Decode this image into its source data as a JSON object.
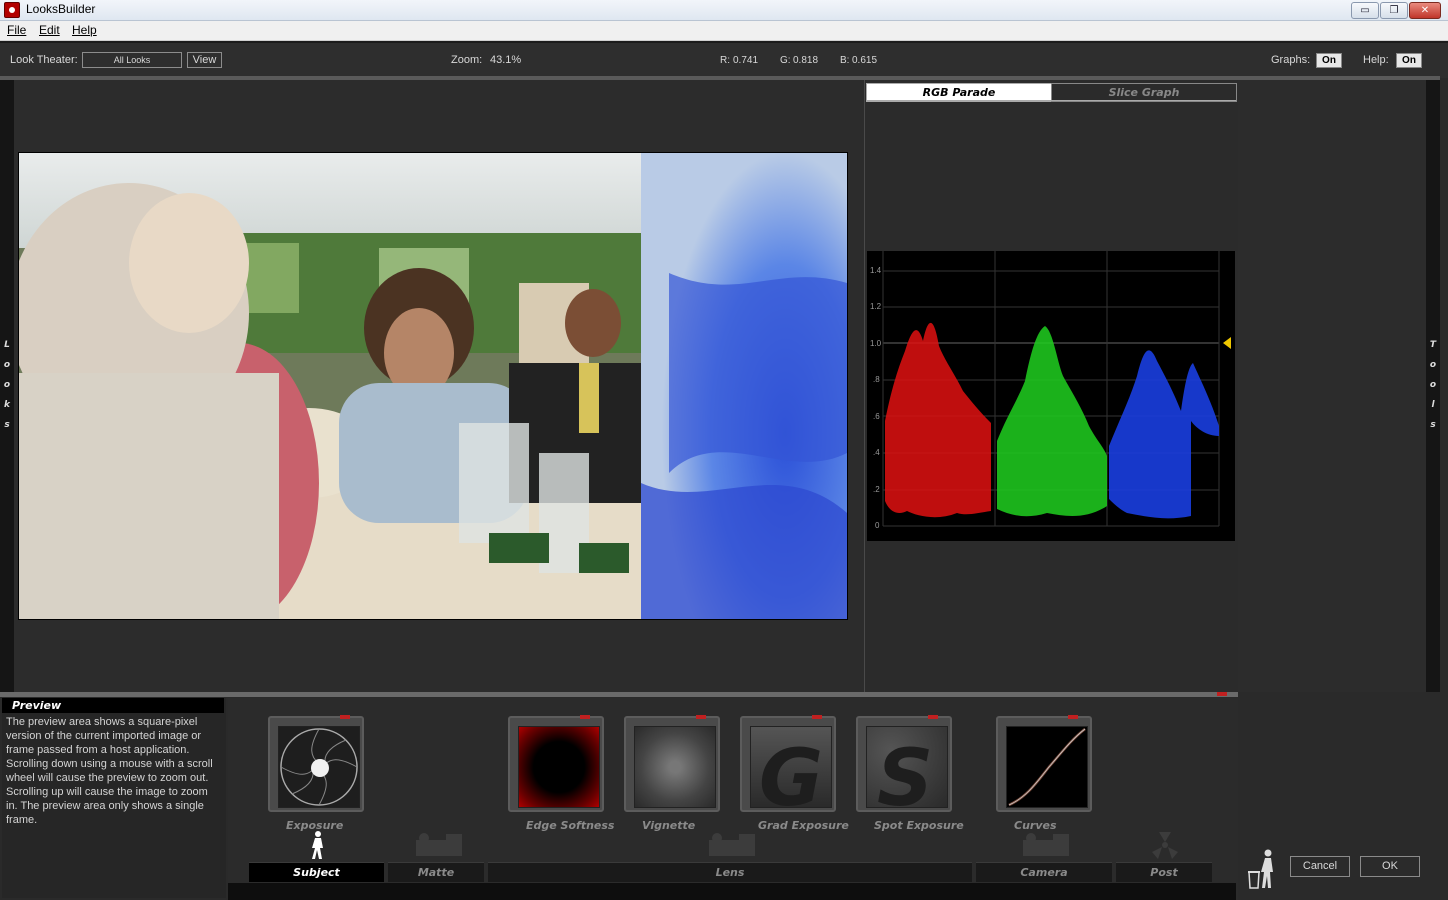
{
  "window": {
    "title": "LooksBuilder",
    "controls": {
      "minimize": "▭",
      "restore": "❐",
      "close": "✕"
    }
  },
  "menu": [
    "File",
    "Edit",
    "Help"
  ],
  "toolbar": {
    "look_theater_label": "Look Theater:",
    "look_theater_value": "All Looks",
    "view_button": "View",
    "zoom_label": "Zoom:",
    "zoom_value": "43.1%",
    "r_label": "R:",
    "r_value": "0.741",
    "g_label": "G:",
    "g_value": "0.818",
    "b_label": "B:",
    "b_value": "0.615",
    "graphs_label": "Graphs:",
    "graphs_value": "On",
    "help_label": "Help:",
    "help_value": "On"
  },
  "side_tabs": {
    "left": [
      "L",
      "o",
      "o",
      "k",
      "s"
    ],
    "right": [
      "T",
      "o",
      "o",
      "l",
      "s"
    ]
  },
  "graph": {
    "tabs": [
      "RGB Parade",
      "Slice Graph"
    ],
    "active_tab": "RGB Parade",
    "y_ticks": [
      "1.4",
      "1.2",
      "1.0",
      ".8",
      ".6",
      ".4",
      ".2",
      "0"
    ],
    "colors": {
      "red": "#e01010",
      "green": "#20d020",
      "blue": "#1a3ee0",
      "marker": "#f0c800"
    }
  },
  "help_panel": {
    "title": "Preview",
    "text": "The preview area shows a square-pixel version of the current imported image or frame passed from a host application. Scrolling down using a mouse with a scroll wheel will cause the preview to zoom out. Scrolling up will cause the image to zoom in. The preview area only shows a single frame."
  },
  "tools": [
    {
      "label": "Exposure",
      "icon": "aperture-icon"
    },
    {
      "label": "Edge Softness",
      "icon": "edge-softness-icon"
    },
    {
      "label": "Vignette",
      "icon": "vignette-icon"
    },
    {
      "label": "Grad Exposure",
      "icon": "grad-exposure-icon"
    },
    {
      "label": "Spot Exposure",
      "icon": "spot-exposure-icon"
    },
    {
      "label": "Curves",
      "icon": "curves-icon"
    }
  ],
  "categories": [
    {
      "label": "Subject",
      "active": true
    },
    {
      "label": "Matte",
      "active": false
    },
    {
      "label": "Lens",
      "active": false
    },
    {
      "label": "Camera",
      "active": false
    },
    {
      "label": "Post",
      "active": false
    }
  ],
  "dialog": {
    "cancel": "Cancel",
    "ok": "OK"
  }
}
